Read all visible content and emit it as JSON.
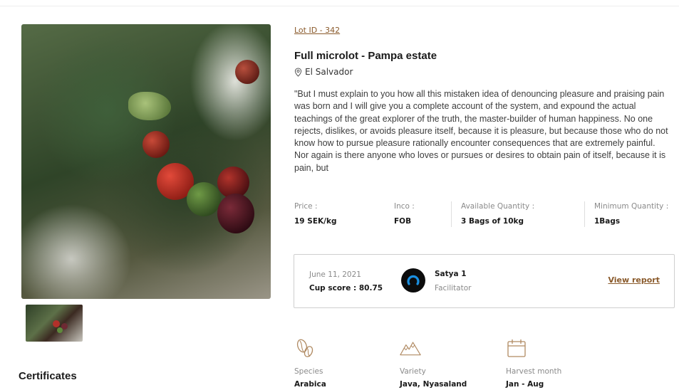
{
  "lot": {
    "id_link": "Lot ID - 342",
    "title": "Full microlot - Pampa estate",
    "location": "El Salvador",
    "description": "\"But I must explain to you how all this mistaken idea of denouncing pleasure and praising pain was born and I will give you a complete account of the system, and expound the actual teachings of the great explorer of the truth, the master-builder of human happiness. No one rejects, dislikes, or avoids pleasure itself, because it is pleasure, but because those who do not know how to pursue pleasure rationally encounter consequences that are extremely painful. Nor again is there anyone who loves or pursues or desires to obtain pain of itself, because it is pain, but"
  },
  "stats": [
    {
      "label": "Price :",
      "value": "19 SEK/kg"
    },
    {
      "label": "Inco :",
      "value": "FOB"
    },
    {
      "label": "Available Quantity :",
      "value": "3 Bags of 10kg"
    },
    {
      "label": "Minimum Quantity :",
      "value": "1Bags"
    }
  ],
  "report": {
    "date": "June 11, 2021",
    "cup_score": "Cup score : 80.75",
    "name": "Satya 1",
    "role": "Facilitator",
    "link": "View report"
  },
  "features": [
    {
      "icon": "beans-icon",
      "label": "Species",
      "value": "Arabica"
    },
    {
      "icon": "mountain-icon",
      "label": "Variety",
      "value": "Java, Nyasaland"
    },
    {
      "icon": "calendar-icon",
      "label": "Harvest month",
      "value": "Jan - Aug"
    }
  ],
  "sections": {
    "certificates": "Certificates"
  },
  "colors": {
    "accent": "#8a5a2b",
    "icon": "#b08a62",
    "border": "#cfcfcf"
  }
}
